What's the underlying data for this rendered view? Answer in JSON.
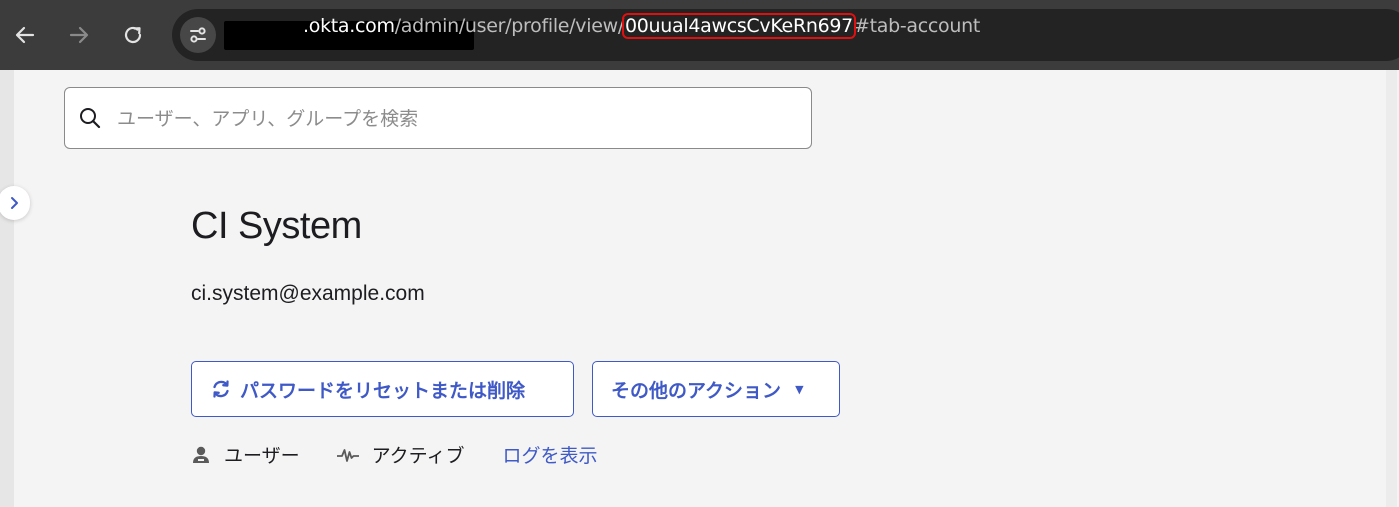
{
  "browser": {
    "url_host": ".okta.com",
    "url_path": "/admin/user/profile/view/",
    "url_user_id": "00uual4awcsCvKeRn697",
    "url_hash": "#tab-account",
    "icons": {
      "back": "arrow-left-icon",
      "forward": "arrow-right-icon",
      "reload": "reload-icon",
      "site_info": "tune-icon"
    }
  },
  "search": {
    "placeholder": "ユーザー、アプリ、グループを検索",
    "value": ""
  },
  "profile": {
    "name": "CI System",
    "email": "ci.system@example.com"
  },
  "actions": {
    "reset_password_label": "パスワードをリセットまたは削除",
    "more_actions_label": "その他のアクション"
  },
  "meta": {
    "type_label": "ユーザー",
    "status_label": "アクティブ",
    "view_logs_label": "ログを表示"
  },
  "colors": {
    "accent": "#3f59c7",
    "text": "#1d1d21",
    "page_bg": "#f4f4f4",
    "browser_bar": "#3c3c3c",
    "highlight": "#e01010"
  }
}
